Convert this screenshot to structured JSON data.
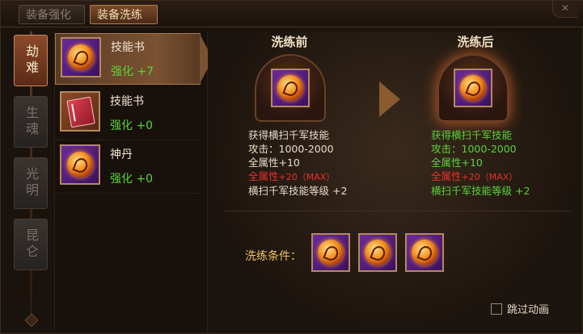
{
  "tabs": {
    "strengthen": "装备强化",
    "refine": "装备洗练"
  },
  "categories": [
    "劫难",
    "生魂",
    "光明",
    "昆仑"
  ],
  "items": [
    {
      "name": "技能书",
      "level": "强化 +7",
      "icon": "fire-orb-icon"
    },
    {
      "name": "技能书",
      "level": "强化 +0",
      "icon": "skill-book-icon"
    },
    {
      "name": "神丹",
      "level": "强化 +0",
      "icon": "fire-orb-icon"
    }
  ],
  "before": {
    "title": "洗练前",
    "lines": [
      "获得横扫千军技能",
      "攻击：1000-2000",
      "全属性+10",
      "全属性",
      "+20（MAX）",
      "横扫千军技能等级 +2"
    ]
  },
  "after": {
    "title": "洗练后",
    "lines": [
      "获得横扫千军技能",
      "攻击：1000-2000",
      "全属性+10",
      "全属性",
      "+20（MAX）",
      "横扫千军技能等级 +2"
    ]
  },
  "conditions": {
    "label": "洗练条件："
  },
  "skip_animation": {
    "label": "跳过动画",
    "checked": false
  },
  "colors": {
    "green": "#5ad23a",
    "red": "#e8302a",
    "gold": "#f0c060"
  }
}
